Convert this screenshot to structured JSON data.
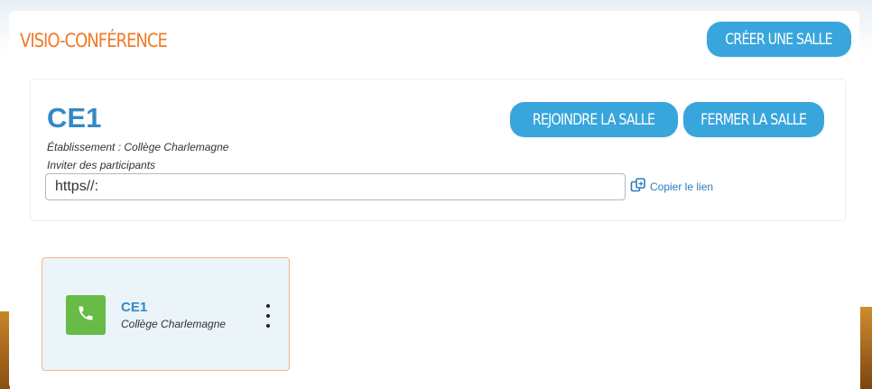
{
  "header": {
    "title": "VISIO-CONFÉRENCE",
    "create_button_label": "CRÉER UNE SALLE"
  },
  "room_card": {
    "name": "CE1",
    "school_line": "Établissement : Collège Charlemagne",
    "invite_label": "Inviter des participants",
    "link_value": "https//:",
    "copy_link_label": "Copier le lien",
    "join_button_label": "REJOINDRE LA SALLE",
    "close_button_label": "FERMER LA SALLE",
    "copy_icon": "copy-icon"
  },
  "room_list": [
    {
      "name": "CE1",
      "school": "Collège Charlemagne",
      "icon": "phone-icon",
      "menu_icon": "more-vertical-icon"
    }
  ],
  "colors": {
    "title_orange": "#f07a2a",
    "button_blue": "#38a5dd",
    "room_name_blue": "#3389c4",
    "tile_border": "#f7b486",
    "tile_background": "#eaf4f9",
    "phone_green": "#67bb46"
  }
}
